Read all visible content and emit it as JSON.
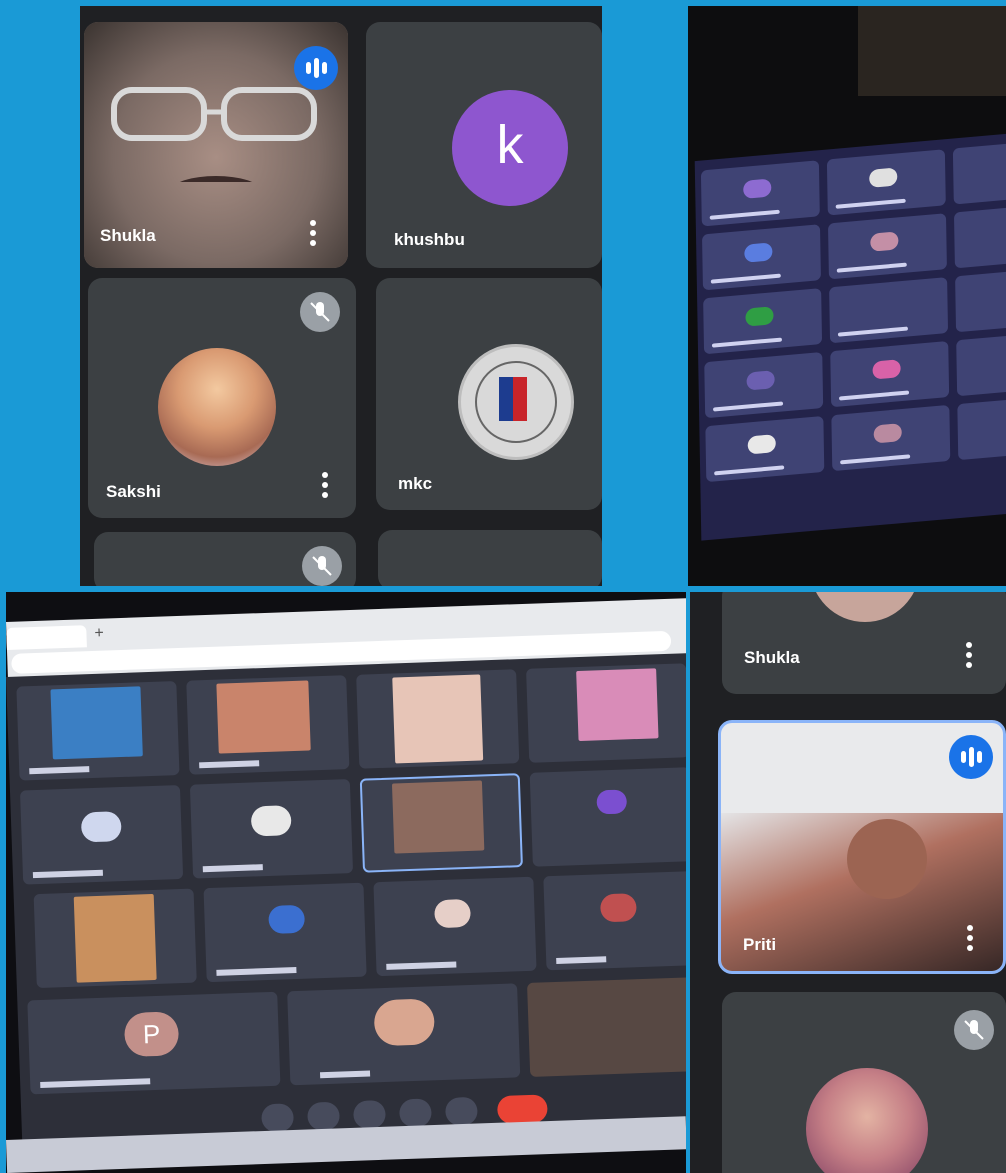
{
  "top_left": {
    "tiles": [
      {
        "name": "Shukla",
        "kind": "video-speaking"
      },
      {
        "name": "khushbu",
        "kind": "initial",
        "initial": "k"
      },
      {
        "name": "Sakshi",
        "kind": "photo-muted"
      },
      {
        "name": "mkc",
        "kind": "logo"
      }
    ]
  },
  "bottom_right": {
    "tiles": [
      {
        "name": "Shukla",
        "kind": "photo"
      },
      {
        "name": "Priti",
        "kind": "video-speaking"
      },
      {
        "name": "",
        "kind": "photo-muted"
      }
    ]
  },
  "bottom_left": {
    "large_tile_initial": "P"
  },
  "colors": {
    "background_blue": "#1a9ad6",
    "tile_dark": "#3c4043",
    "speaking_blue": "#1a73e8",
    "avatar_purple": "#8e56cf",
    "end_call_red": "#ea4335"
  }
}
